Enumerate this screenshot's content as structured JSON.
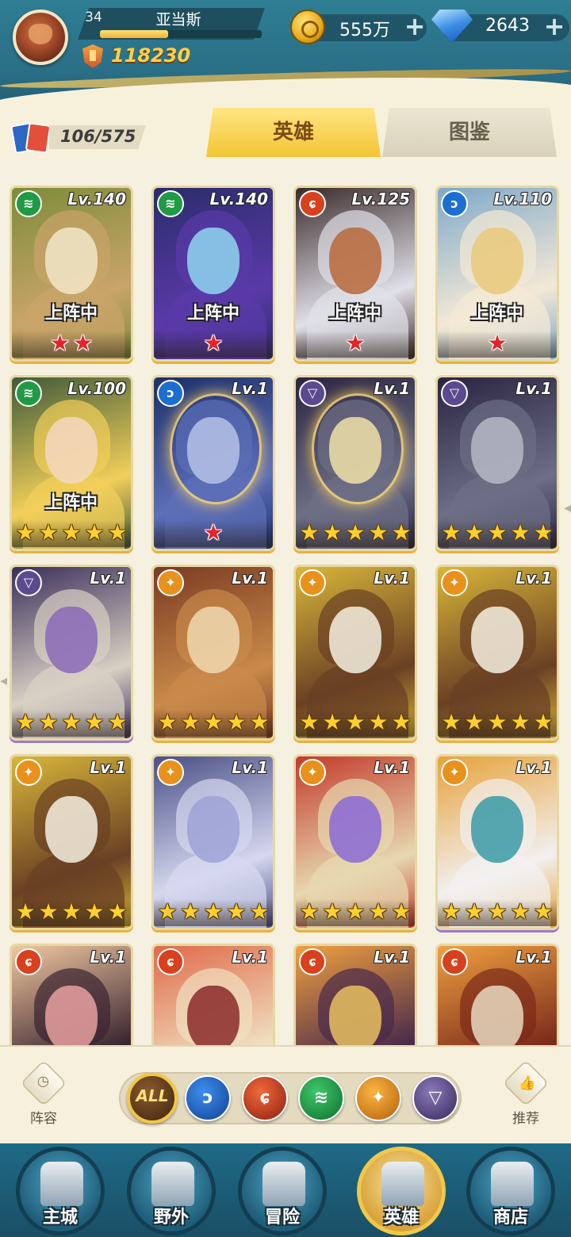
{
  "player": {
    "level": "34",
    "name": "亚当斯",
    "xp_progress": 0.42,
    "power": "118230"
  },
  "resources": {
    "gold": "555万",
    "gems": "2643"
  },
  "collection": {
    "count": "106/575"
  },
  "tabs": [
    {
      "label": "英雄",
      "active": true
    },
    {
      "label": "图鉴",
      "active": false
    }
  ],
  "heroes": [
    {
      "element": "wind",
      "level": "Lv.140",
      "status": "上阵中",
      "stars": 2,
      "star_color": "red",
      "palette": [
        "#7d8c3a",
        "#c9a46a",
        "#f2e6c8"
      ]
    },
    {
      "element": "wind",
      "level": "Lv.140",
      "status": "上阵中",
      "stars": 1,
      "star_color": "red",
      "palette": [
        "#2a2c6b",
        "#5a3aa8",
        "#8fd6f0"
      ]
    },
    {
      "element": "fire",
      "level": "Lv.125",
      "status": "上阵中",
      "stars": 1,
      "star_color": "red",
      "palette": [
        "#3a2a2a",
        "#e0e0e8",
        "#b7693a"
      ]
    },
    {
      "element": "water",
      "level": "Lv.110",
      "status": "上阵中",
      "stars": 1,
      "star_color": "red",
      "palette": [
        "#7fa8c9",
        "#f4e9d6",
        "#e9c97a"
      ]
    },
    {
      "element": "wind",
      "level": "Lv.100",
      "status": "上阵中",
      "stars": 5,
      "star_color": "gold",
      "palette": [
        "#3f5a3a",
        "#f2cf5a",
        "#f3d8c0"
      ]
    },
    {
      "element": "water",
      "level": "Lv.1",
      "status": "",
      "stars": 1,
      "star_color": "red",
      "palette": [
        "#1c2f6a",
        "#5d6fb8",
        "#b6c2e6"
      ],
      "aura": true
    },
    {
      "element": "dark",
      "level": "Lv.1",
      "status": "",
      "stars": 5,
      "star_color": "gold",
      "palette": [
        "#2a2442",
        "#6d6f86",
        "#f0e0a8"
      ],
      "aura": true
    },
    {
      "element": "dark",
      "level": "Lv.1",
      "status": "",
      "stars": 5,
      "star_color": "gold",
      "palette": [
        "#2a2442",
        "#6d6f86",
        "#b7b9c6"
      ]
    },
    {
      "element": "dark",
      "level": "Lv.1",
      "status": "",
      "stars": 5,
      "star_color": "gold",
      "palette": [
        "#3a2f5a",
        "#d9d0c4",
        "#8a6ab8"
      ],
      "frame": "purple"
    },
    {
      "element": "light",
      "level": "Lv.1",
      "status": "",
      "stars": 5,
      "star_color": "gold",
      "palette": [
        "#7a3a22",
        "#c98a4a",
        "#f0d8b0"
      ]
    },
    {
      "element": "light",
      "level": "Lv.1",
      "status": "",
      "stars": 5,
      "star_color": "gold",
      "palette": [
        "#d9b63a",
        "#6a4024",
        "#f5f0e0"
      ]
    },
    {
      "element": "light",
      "level": "Lv.1",
      "status": "",
      "stars": 5,
      "star_color": "gold",
      "palette": [
        "#d9b63a",
        "#6a4024",
        "#f5f0e0"
      ]
    },
    {
      "element": "light",
      "level": "Lv.1",
      "status": "",
      "stars": 5,
      "star_color": "gold",
      "palette": [
        "#d9b63a",
        "#6a4024",
        "#f5f0e0"
      ]
    },
    {
      "element": "light",
      "level": "Lv.1",
      "status": "",
      "stars": 5,
      "star_color": "gold",
      "palette": [
        "#4a4f86",
        "#d6d8ef",
        "#9ea2d6"
      ]
    },
    {
      "element": "light",
      "level": "Lv.1",
      "status": "",
      "stars": 5,
      "star_color": "gold",
      "palette": [
        "#c23a2a",
        "#e7d8b0",
        "#8a6ad6"
      ]
    },
    {
      "element": "light",
      "level": "Lv.1",
      "status": "",
      "stars": 5,
      "star_color": "gold",
      "palette": [
        "#e7a23a",
        "#f2f0f0",
        "#3a9aa6"
      ],
      "frame": "purple"
    },
    {
      "element": "fire",
      "level": "Lv.1",
      "status": "",
      "stars": 0,
      "star_color": "gold",
      "palette": [
        "#f0c8a0",
        "#3a2430",
        "#e8a0a0"
      ]
    },
    {
      "element": "fire",
      "level": "Lv.1",
      "status": "",
      "stars": 0,
      "star_color": "gold",
      "palette": [
        "#e06a4a",
        "#f0e0c0",
        "#8a2a2a"
      ]
    },
    {
      "element": "fire",
      "level": "Lv.1",
      "status": "",
      "stars": 0,
      "star_color": "gold",
      "palette": [
        "#f0a040",
        "#4a2a4a",
        "#e8c060"
      ]
    },
    {
      "element": "fire",
      "level": "Lv.1",
      "status": "",
      "stars": 0,
      "star_color": "gold",
      "palette": [
        "#f0a040",
        "#7a2a1a",
        "#e8d8c0"
      ]
    }
  ],
  "filters": [
    {
      "id": "all",
      "label": "ALL",
      "active": true
    },
    {
      "id": "water",
      "label": "",
      "icon": "water-element-icon"
    },
    {
      "id": "fire",
      "label": "",
      "icon": "fire-element-icon"
    },
    {
      "id": "wind",
      "label": "",
      "icon": "wind-element-icon"
    },
    {
      "id": "light",
      "label": "",
      "icon": "light-element-icon"
    },
    {
      "id": "dark",
      "label": "",
      "icon": "dark-element-icon"
    }
  ],
  "side_buttons": {
    "lineup": "阵容",
    "recommend": "推荐"
  },
  "nav": {
    "city": "主城",
    "wild": "野外",
    "adventure": "冒险",
    "heroes": "英雄",
    "shop": "商店",
    "active": "heroes"
  },
  "element_colors": {
    "wind": "#1f9a45",
    "water": "#1c6fd1",
    "fire": "#d8401e",
    "light": "#e8911c",
    "dark": "#5b4a8e"
  },
  "element_glyphs": {
    "wind": "≋",
    "water": "ↄ",
    "fire": "ɕ",
    "light": "✦",
    "dark": "▽"
  }
}
